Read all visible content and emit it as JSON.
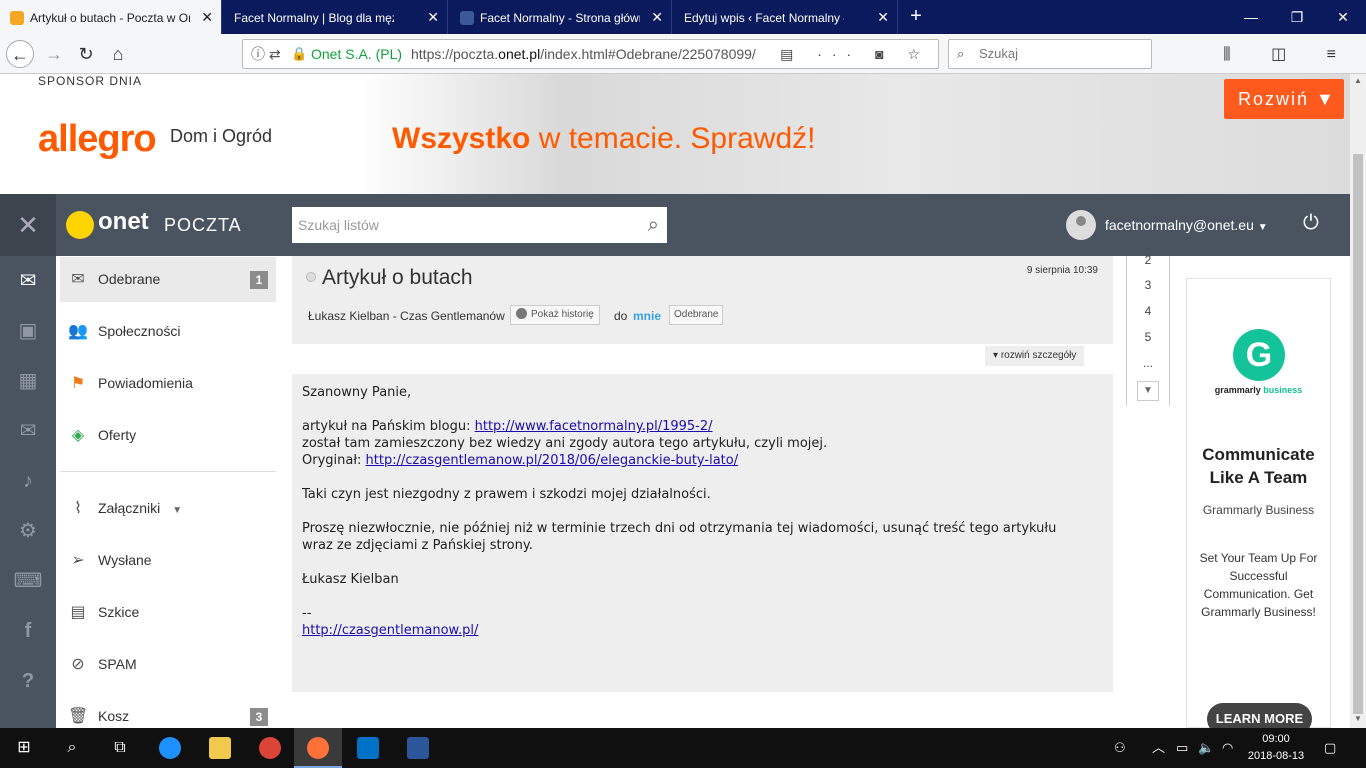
{
  "browser": {
    "tabs": [
      {
        "label": "Artykuł o butach - Poczta w Onet",
        "active": true,
        "favicon_color": "#f5a623"
      },
      {
        "label": "Facet Normalny | Blog dla mężczyzn",
        "active": false,
        "favicon_color": "#0a1a5c"
      },
      {
        "label": "Facet Normalny - Strona główna",
        "active": false,
        "favicon_color": "#3b5998"
      },
      {
        "label": "Edytuj wpis ‹ Facet Normalny — WordPress",
        "active": false,
        "favicon_color": "#0a1a5c"
      }
    ],
    "site_identity": "Onet S.A. (PL)",
    "url_prefix": "https://poczta.",
    "url_domain": "onet.pl",
    "url_rest": "/index.html#Odebrane/225078099/",
    "search_placeholder": "Szukaj"
  },
  "banner": {
    "sponsor_label": "SPONSOR DNIA",
    "logo_text": "allegro",
    "category": "Dom i Ogród",
    "slogan_bold": "Wszystko",
    "slogan_rest": " w temacie. Sprawdź!",
    "expand_label": "Rozwiń",
    "accent_color": "#ff5a00"
  },
  "header": {
    "brand": "onet",
    "product": "POCZTA",
    "search_placeholder": "Szukaj listów",
    "user_email": "facetnormalny@onet.eu"
  },
  "folders": [
    {
      "label": "Odebrane",
      "icon": "envelope-icon",
      "count": "1",
      "active": true
    },
    {
      "label": "Społeczności",
      "icon": "people-icon",
      "count": "",
      "active": false
    },
    {
      "label": "Powiadomienia",
      "icon": "flag-icon",
      "count": "",
      "active": false
    },
    {
      "label": "Oferty",
      "icon": "tag-icon",
      "count": "",
      "active": false
    },
    {
      "label": "Załączniki",
      "icon": "paperclip-icon",
      "count": "",
      "active": false
    },
    {
      "label": "Wysłane",
      "icon": "send-icon",
      "count": "",
      "active": false
    },
    {
      "label": "Szkice",
      "icon": "draft-icon",
      "count": "",
      "active": false
    },
    {
      "label": "SPAM",
      "icon": "spam-icon",
      "count": "",
      "active": false
    },
    {
      "label": "Kosz",
      "icon": "trash-icon",
      "count": "3",
      "active": false
    }
  ],
  "message": {
    "subject": "Artykuł o butach",
    "date": "9 sierpnia 10:39",
    "from": "Łukasz Kielban - Czas Gentlemanów",
    "history_label": "Pokaż historię",
    "to_prefix": "do",
    "to": "mnie",
    "folder_badge": "Odebrane",
    "details_label": "rozwiń szczegóły",
    "greeting": "Szanowny Panie,",
    "line1_text": "artykuł na Pańskim blogu: ",
    "line1_link": "http://www.facetnormalny.pl/1995-2/",
    "line2": "został tam zamieszczony bez wiedzy ani zgody autora tego artykułu, czyli mojej.",
    "line3_text": "Oryginał: ",
    "line3_link": "http://czasgentlemanow.pl/2018/06/eleganckie-buty-lato/",
    "para2": "Taki czyn jest niezgodny z prawem i szkodzi mojej działalności.",
    "para3": "Proszę niezwłocznie, nie później niż w terminie trzech dni od otrzymania tej wiadomości, usunąć treść tego artykułu wraz ze zdjęciami z Pańskiej strony.",
    "signature": "Łukasz Kielban",
    "sig_sep": "--",
    "sig_link": "http://czasgentlemanow.pl/"
  },
  "pager": [
    "2",
    "3",
    "4",
    "5",
    "..."
  ],
  "ad": {
    "brand_name": "grammarly",
    "brand_suffix": "business",
    "headline_1": "Communicate",
    "headline_2": "Like A Team",
    "subline": "Grammarly Business",
    "description": "Set Your Team Up For Successful Communication. Get Grammarly Business!",
    "cta": "LEARN MORE",
    "brand_color": "#15c39a"
  },
  "taskbar": {
    "time": "09:00",
    "date": "2018-08-13"
  }
}
